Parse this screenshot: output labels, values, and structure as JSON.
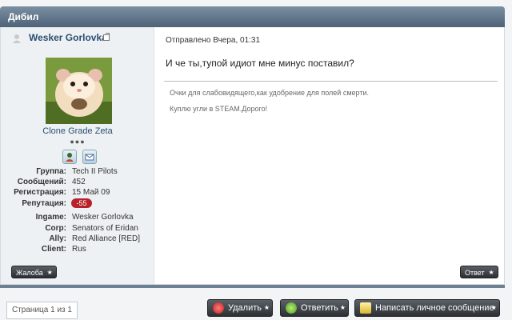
{
  "topic": {
    "title": "Дибил"
  },
  "author": {
    "name": "Wesker Gorlovka",
    "rank": "Clone Grade Zeta",
    "pips": "●●●",
    "avatar_icon": "hamster-avatar",
    "fields": [
      {
        "key": "Группа:",
        "value": "Tech II Pilots"
      },
      {
        "key": "Сообщений:",
        "value": "452"
      },
      {
        "key": "Регистрация:",
        "value": "15 Май 09"
      },
      {
        "key": "Репутация:",
        "value": "-55"
      }
    ],
    "custom_fields": [
      {
        "key": "Ingame:",
        "value": "Wesker Gorlovka"
      },
      {
        "key": "Corp:",
        "value": "Senators of Eridan"
      },
      {
        "key": "Ally:",
        "value": "Red Alliance [RED]"
      },
      {
        "key": "Client:",
        "value": "Rus"
      }
    ],
    "report_label": "Жалоба"
  },
  "post": {
    "date": "Отправлено Вчера, 01:31",
    "body": "И че ты,тупой идиот мне минус поставил?",
    "signature": [
      "Очки для слабовидящего,как удобрение для полей смерти.",
      "Куплю угли в STEAM.Дорого!"
    ],
    "reply_label": "Ответ"
  },
  "pager": {
    "text": "Страница 1 из 1"
  },
  "actions": {
    "delete": "Удалить",
    "answer": "Ответить",
    "new_pm": "Написать личное сообщение"
  },
  "colors": {
    "rep_negative": "#b8202a",
    "title_bar": "#5f7388",
    "link": "#2c4e72"
  }
}
